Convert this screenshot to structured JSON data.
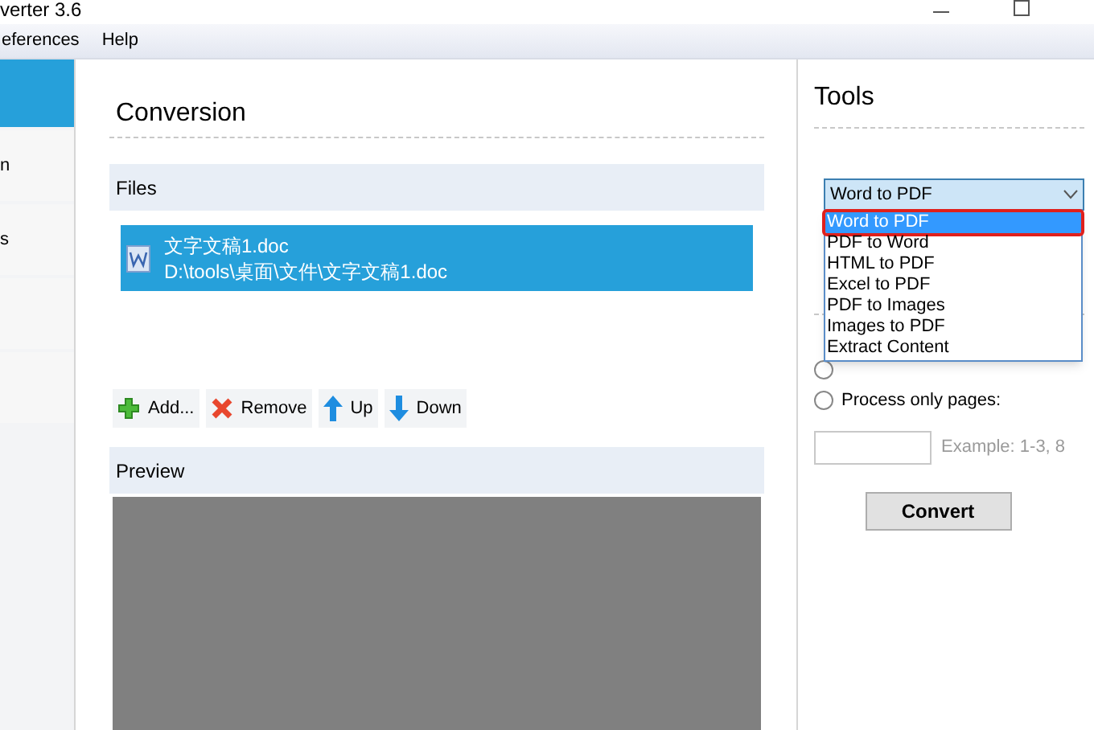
{
  "window": {
    "title": "verter 3.6"
  },
  "menu": [
    {
      "label": "eferences"
    },
    {
      "label": "Help"
    }
  ],
  "sidebar": {
    "items": [
      {
        "label": "n",
        "selected": false
      },
      {
        "label": "s",
        "selected": false
      },
      {
        "selected": false
      },
      {
        "selected": false
      }
    ]
  },
  "conversion": {
    "title": "Conversion",
    "files_header": "Files",
    "files": [
      {
        "name": "文字文稿1.doc",
        "path": "D:\\tools\\桌面\\文件\\文字文稿1.doc",
        "selected": true
      }
    ],
    "actions": [
      {
        "kind": "add",
        "label": "Add..."
      },
      {
        "kind": "remove",
        "label": "Remove"
      },
      {
        "kind": "up",
        "label": "Up"
      },
      {
        "kind": "down",
        "label": "Down"
      }
    ],
    "preview_header": "Preview"
  },
  "tools": {
    "title": "Tools",
    "dropdown": {
      "value": "Word to PDF",
      "expanded": true,
      "options": [
        {
          "label": "Word to PDF",
          "selected": true
        },
        {
          "label": "PDF to Word",
          "selected": false
        },
        {
          "label": "HTML to PDF",
          "selected": false
        },
        {
          "label": "Excel to PDF",
          "selected": false
        },
        {
          "label": "PDF to Images",
          "selected": false
        },
        {
          "label": "Images to PDF",
          "selected": false
        },
        {
          "label": "Extract Content",
          "selected": false
        }
      ]
    },
    "radios": [
      {
        "selected": false
      },
      {
        "label": "Process only pages:",
        "selected": false
      }
    ],
    "pages_hint": "Example: 1-3, 8",
    "convert": "Convert"
  }
}
